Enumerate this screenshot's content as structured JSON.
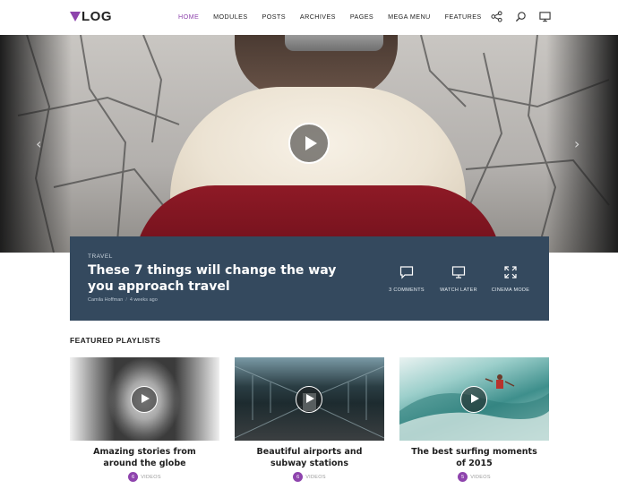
{
  "header": {
    "logo_text": "LOG",
    "nav": [
      "HOME",
      "MODULES",
      "POSTS",
      "ARCHIVES",
      "PAGES",
      "MEGA MENU",
      "FEATURES"
    ],
    "active_nav": "HOME"
  },
  "hero": {
    "category": "TRAVEL",
    "title": "These 7 things will change the way you approach travel",
    "author": "Camila Hoffman",
    "time": "4 weeks ago",
    "actions": {
      "comments": "3 COMMENTS",
      "watch_later": "WATCH LATER",
      "cinema_mode": "CINEMA MODE"
    }
  },
  "playlists": {
    "section_title": "FEATURED PLAYLISTS",
    "items": [
      {
        "title_line1": "Amazing stories from",
        "title_line2": "around the globe",
        "count": "6",
        "label": "VIDEOS"
      },
      {
        "title_line1": "Beautiful airports and",
        "title_line2": "subway stations",
        "count": "6",
        "label": "VIDEOS"
      },
      {
        "title_line1": "The best surfing moments",
        "title_line2": "of 2015",
        "count": "5",
        "label": "VIDEOS"
      }
    ]
  },
  "colors": {
    "accent": "#8e44ad",
    "card_bg": "#34495e"
  }
}
